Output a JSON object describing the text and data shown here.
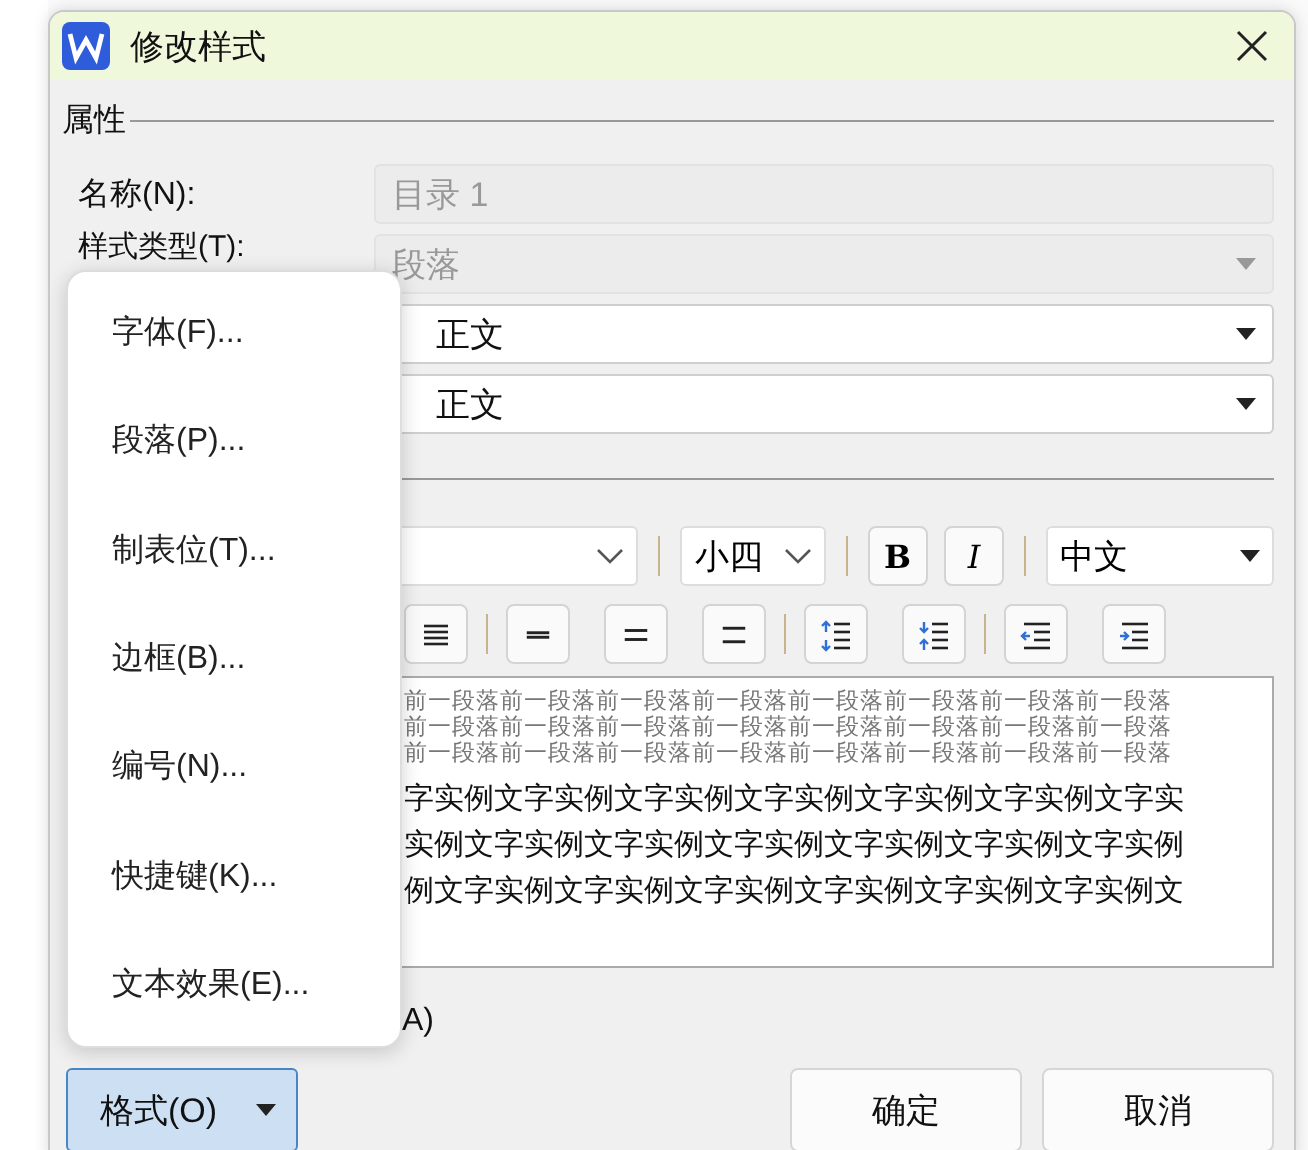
{
  "window": {
    "title": "修改样式"
  },
  "properties": {
    "heading": "属性",
    "name": {
      "label": "名称(N):",
      "value": "目录 1",
      "disabled": true
    },
    "style_type": {
      "label": "样式类型(T):",
      "value": "段落",
      "disabled": true
    },
    "style_based_on": {
      "value": "正文",
      "disabled": false
    },
    "next_style": {
      "value": "正文",
      "disabled": false
    }
  },
  "formatting": {
    "font_size": "小四",
    "bold": "B",
    "italic": "I",
    "script": "中文",
    "paragraph_buttons": [
      {
        "kind": "justify"
      },
      {
        "kind": "spacing_single"
      },
      {
        "kind": "spacing_onehalf"
      },
      {
        "kind": "spacing_double"
      },
      {
        "kind": "space_before"
      },
      {
        "kind": "space_after"
      },
      {
        "kind": "indent_decrease"
      },
      {
        "kind": "indent_increase"
      }
    ]
  },
  "preview": {
    "preceding_lines": [
      "前一段落前一段落前一段落前一段落前一段落前一段落前一段落前一段落",
      "前一段落前一段落前一段落前一段落前一段落前一段落前一段落前一段落",
      "前一段落前一段落前一段落前一段落前一段落前一段落前一段落前一段落"
    ],
    "sample_lines": [
      "字实例文字实例文字实例文字实例文字实例文字实例文字实",
      "实例文字实例文字实例文字实例文字实例文字实例文字实例",
      "例文字实例文字实例文字实例文字实例文字实例文字实例文"
    ]
  },
  "option_label": "A)",
  "format_menu": {
    "open": true,
    "items": [
      "字体(F)...",
      "段落(P)...",
      "制表位(T)...",
      "边框(B)...",
      "编号(N)...",
      "快捷键(K)...",
      "文本效果(E)..."
    ]
  },
  "buttons": {
    "format": "格式(O)",
    "ok": "确定",
    "cancel": "取消"
  }
}
